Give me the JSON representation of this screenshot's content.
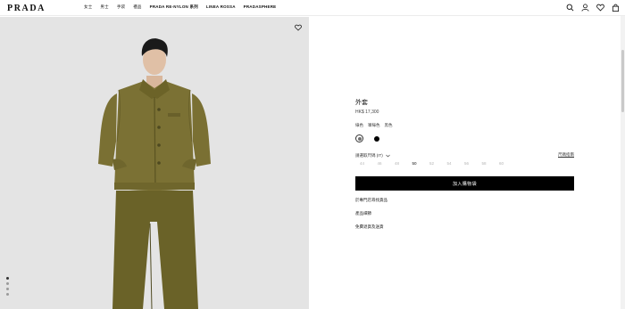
{
  "header": {
    "logo": "PRADA",
    "nav": [
      {
        "label": "女士",
        "cn": true
      },
      {
        "label": "男士",
        "cn": true
      },
      {
        "label": "手袋",
        "cn": true
      },
      {
        "label": "禮品",
        "cn": true
      },
      {
        "label": "PRADA RE-NYLON 系列",
        "cn": false
      },
      {
        "label": "LINEA ROSSA",
        "cn": false
      },
      {
        "label": "PRADASPHERE",
        "cn": false
      }
    ],
    "icons": [
      "search-icon",
      "account-icon",
      "wishlist-icon",
      "bag-icon"
    ]
  },
  "gallery": {
    "slide_count": 4,
    "active_index": 0
  },
  "product": {
    "name": "外套",
    "price": "HK$ 17,300",
    "colors": [
      "綠色",
      "軍綠色",
      "黑色"
    ],
    "swatch_colors": [
      "#707070",
      "#000000"
    ],
    "size_label": "請選取尺碼 (IT)",
    "size_guide": "尺碼指南",
    "sizes": [
      "44",
      "46",
      "48",
      "50",
      "52",
      "54",
      "56",
      "58",
      "60"
    ],
    "selected_size": "50",
    "add_to_bag": "加入購物袋",
    "links": [
      "於專門店尋找貨品",
      "產品細節",
      "免費退貨及送貨"
    ]
  }
}
